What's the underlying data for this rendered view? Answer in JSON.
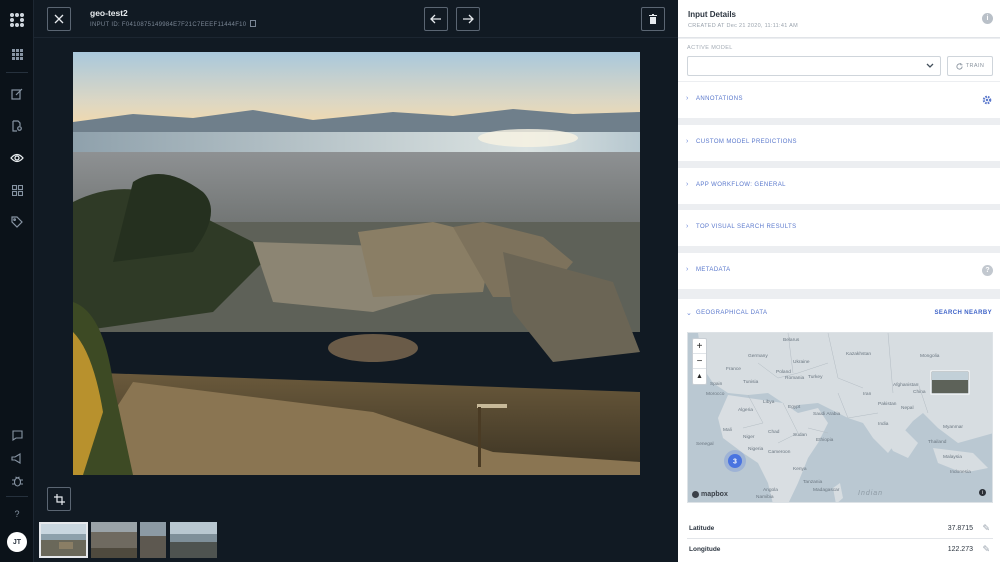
{
  "header": {
    "title": "geo-test2",
    "input_id": "INPUT ID: F0410875149984E7F21C7EEEF11444F10"
  },
  "panel": {
    "title": "Input Details",
    "created": "CREATED AT  Dec 21 2020, 11:11:41 AM",
    "active_model_label": "ACTIVE MODEL",
    "active_model_value": "",
    "train_label": "TRAIN",
    "sections": [
      {
        "label": "ANNOTATIONS"
      },
      {
        "label": "CUSTOM MODEL PREDICTIONS"
      },
      {
        "label": "APP WORKFLOW: GENERAL"
      },
      {
        "label": "TOP VISUAL SEARCH RESULTS"
      },
      {
        "label": "METADATA"
      }
    ],
    "geo": {
      "label": "GEOGRAPHICAL DATA",
      "search_label": "SEARCH NEARBY",
      "cluster_count": "3",
      "map_logo": "mapbox",
      "ocean_label": "Indian",
      "map_labels": [
        "Belarus",
        "Kazakhstan",
        "Mongolia",
        "Germany",
        "Ukraine",
        "Poland",
        "France",
        "Romania",
        "Turkey",
        "Spain",
        "China",
        "Tunisia",
        "Iran",
        "Afghanistan",
        "Morocco",
        "Libya",
        "Egypt",
        "Saudi Arabia",
        "Pakistan",
        "Algeria",
        "Nepal",
        "India",
        "Mali",
        "Chad",
        "Sudan",
        "Niger",
        "Myanmar",
        "Senegal",
        "Nigeria",
        "Ethiopia",
        "Thailand",
        "Cameroon",
        "Kenya",
        "Angola",
        "Namibia",
        "Tanzania",
        "Madagascar",
        "Indonesia",
        "Malaysia"
      ],
      "latitude_label": "Latitude",
      "latitude_value": "37.8715",
      "longitude_label": "Longitude",
      "longitude_value": "122.273"
    }
  },
  "rail": {
    "avatar": "JT",
    "help": "?"
  },
  "icons": [
    "close-icon",
    "copy-icon",
    "arrow-left-icon",
    "arrow-right-icon",
    "trash-icon",
    "crop-icon",
    "grid-icon",
    "edit-icon",
    "search-doc-icon",
    "eye-icon",
    "apps-icon",
    "tag-icon",
    "chat-icon",
    "megaphone-icon",
    "bug-icon",
    "info-icon",
    "gear-icon",
    "refresh-icon",
    "pencil-icon",
    "zoom-in-icon",
    "zoom-out-icon",
    "compass-icon"
  ],
  "colors": {
    "accent": "#5a78cc",
    "cluster": "#4a74e0",
    "viewer_bg": "#111a23"
  }
}
